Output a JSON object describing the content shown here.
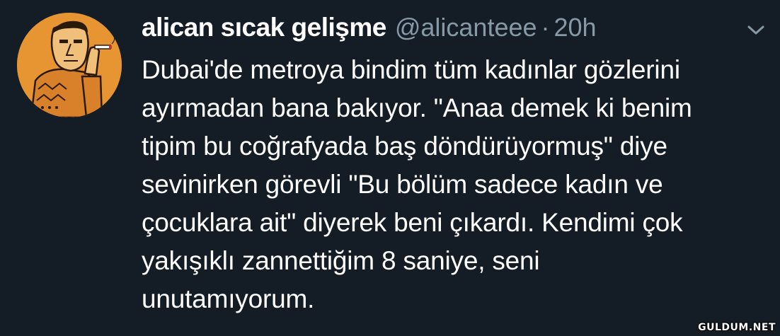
{
  "tweet": {
    "display_name": "alican sıcak gelişme",
    "handle": "@alicanteee",
    "separator": "·",
    "time": "20h",
    "text": "Dubai'de metroya bindim tüm kadınlar gözlerini\nayırmadan bana bakıyor. \"Anaa demek ki benim\ntipim bu coğrafyada baş döndürüyormuş\" diye\nsevinirken görevli \"Bu bölüm sadece kadın ve\nçocuklara ait\" diyerek beni çıkardı. Kendimi çok\nyakışıklı zannettiğim 8 saniye, seni\nunutamıyorum.",
    "avatar_icon": "cartoon-man-avatar",
    "menu_icon": "chevron-down-icon"
  },
  "watermark": "GULDUM.NET",
  "colors": {
    "background": "#141d26",
    "name": "#ffffff",
    "secondary": "#8899a6",
    "avatar_bg": "#e79533"
  }
}
